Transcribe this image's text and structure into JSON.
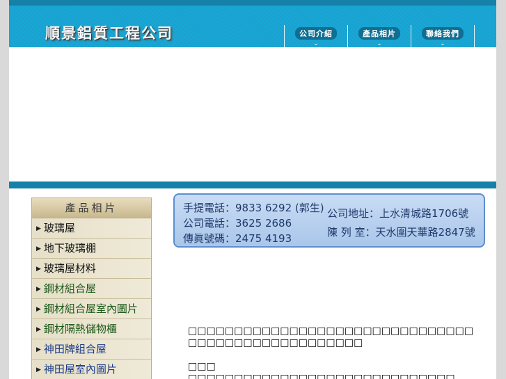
{
  "header": {
    "logo": "順景鋁質工程公司",
    "nav": [
      {
        "label": "公司介紹"
      },
      {
        "label": "產品相片"
      },
      {
        "label": "聯絡我們"
      }
    ],
    "nav_chevron": "⌄"
  },
  "sidebar": {
    "title": "產品相片",
    "items": [
      {
        "label": "玻璃屋"
      },
      {
        "label": "地下玻璃棚"
      },
      {
        "label": "玻璃屋材料"
      },
      {
        "label": "鋼材組合屋"
      },
      {
        "label": "鋼材組合屋室內圖片"
      },
      {
        "label": "鋼材隔熱儲物櫃"
      },
      {
        "label": "神田牌組合屋"
      },
      {
        "label": "神田屋室內圖片"
      }
    ],
    "arrow_glyph": "▶"
  },
  "contact": {
    "mobile": "手提電話：9833 6292 (郭生)",
    "phone": "公司電話：3625 2686",
    "fax": "傳眞號碼：2475 4193",
    "address": "公司地址：上水清城路1706號",
    "showroom": "陳 列 室：天水圍天華路2847號"
  },
  "content": {
    "para1": "□□□□□□□□□□□□□□□□□□□□□□□□□□□□□□□□□□□□□□□□□□□□□□□□□□",
    "para2": "□□□",
    "para3": "□□□□□□□□□□□□□□□□□□□□□□□□□□□□□"
  }
}
